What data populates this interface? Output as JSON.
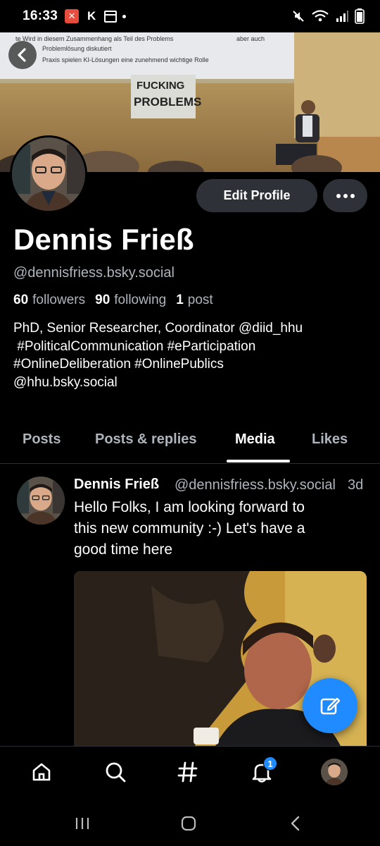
{
  "status_bar": {
    "time": "16:33",
    "app_icons": [
      "x-app-icon",
      "k-app-icon",
      "calendar-icon"
    ],
    "right_icons": [
      "mute-icon",
      "wifi-icon",
      "signal-icon",
      "battery-icon"
    ]
  },
  "banner": {
    "slide_lines": [
      "te Wird in diesem Zusammenhang als Teil des Problems",
      "aber auch",
      "Problemlösung diskutiert",
      "Praxis spielen KI-Lösungen eine zunehmend wichtige Rolle"
    ],
    "poster_text_1": "FUCKING",
    "poster_text_2": "PROBLEMS"
  },
  "profile": {
    "display_name": "Dennis Frieß",
    "handle": "@dennisfriess.bsky.social",
    "followers_count": "60",
    "followers_label": "followers",
    "following_count": "90",
    "following_label": "following",
    "posts_count": "1",
    "posts_label": "post",
    "bio_lines": [
      "PhD, Senior Researcher, Coordinator @diid_hhu",
      " #PoliticalCommunication #eParticipation",
      "#OnlineDeliberation #OnlinePublics",
      "@hhu.bsky.social"
    ],
    "edit_button": "Edit Profile"
  },
  "tabs": [
    {
      "label": "Posts",
      "active": false
    },
    {
      "label": "Posts & replies",
      "active": false
    },
    {
      "label": "Media",
      "active": true
    },
    {
      "label": "Likes",
      "active": false
    }
  ],
  "post": {
    "author": "Dennis Frieß",
    "handle": "@dennisfriess.bsky.social",
    "time": "3d",
    "text_lines": [
      "Hello Folks, I am looking forward to",
      "this new community :-) Let's have a",
      "good time here"
    ]
  },
  "bottom_nav": {
    "items": [
      "home-icon",
      "search-icon",
      "feeds-hash-icon",
      "notifications-icon",
      "profile-avatar"
    ],
    "notification_count": "1"
  },
  "colors": {
    "accent": "#208bfe",
    "background": "#000000",
    "muted_text": "#aeb4bc",
    "button_bg": "#2e3238"
  }
}
